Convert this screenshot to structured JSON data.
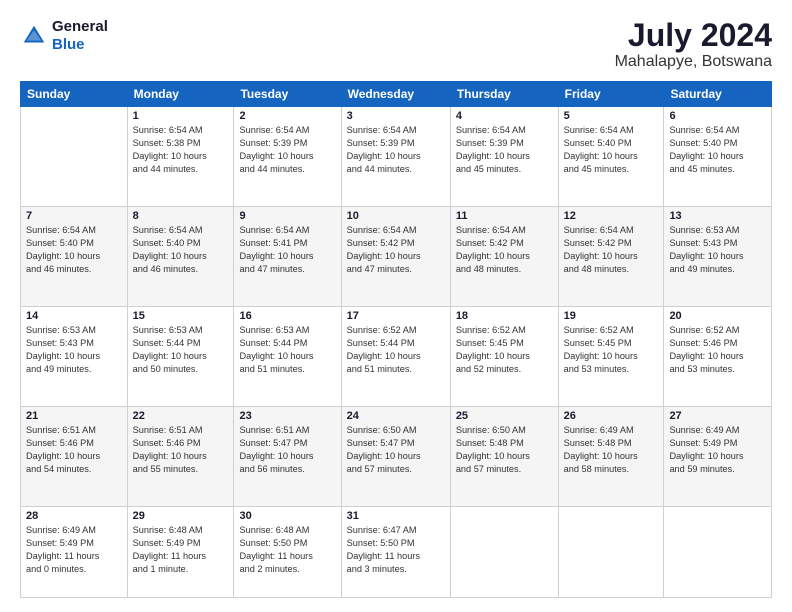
{
  "logo": {
    "line1": "General",
    "line2": "Blue"
  },
  "title": "July 2024",
  "subtitle": "Mahalapye, Botswana",
  "headers": [
    "Sunday",
    "Monday",
    "Tuesday",
    "Wednesday",
    "Thursday",
    "Friday",
    "Saturday"
  ],
  "weeks": [
    [
      {
        "date": "",
        "info": ""
      },
      {
        "date": "1",
        "info": "Sunrise: 6:54 AM\nSunset: 5:38 PM\nDaylight: 10 hours\nand 44 minutes."
      },
      {
        "date": "2",
        "info": "Sunrise: 6:54 AM\nSunset: 5:39 PM\nDaylight: 10 hours\nand 44 minutes."
      },
      {
        "date": "3",
        "info": "Sunrise: 6:54 AM\nSunset: 5:39 PM\nDaylight: 10 hours\nand 44 minutes."
      },
      {
        "date": "4",
        "info": "Sunrise: 6:54 AM\nSunset: 5:39 PM\nDaylight: 10 hours\nand 45 minutes."
      },
      {
        "date": "5",
        "info": "Sunrise: 6:54 AM\nSunset: 5:40 PM\nDaylight: 10 hours\nand 45 minutes."
      },
      {
        "date": "6",
        "info": "Sunrise: 6:54 AM\nSunset: 5:40 PM\nDaylight: 10 hours\nand 45 minutes."
      }
    ],
    [
      {
        "date": "7",
        "info": "Sunrise: 6:54 AM\nSunset: 5:40 PM\nDaylight: 10 hours\nand 46 minutes."
      },
      {
        "date": "8",
        "info": "Sunrise: 6:54 AM\nSunset: 5:40 PM\nDaylight: 10 hours\nand 46 minutes."
      },
      {
        "date": "9",
        "info": "Sunrise: 6:54 AM\nSunset: 5:41 PM\nDaylight: 10 hours\nand 47 minutes."
      },
      {
        "date": "10",
        "info": "Sunrise: 6:54 AM\nSunset: 5:42 PM\nDaylight: 10 hours\nand 47 minutes."
      },
      {
        "date": "11",
        "info": "Sunrise: 6:54 AM\nSunset: 5:42 PM\nDaylight: 10 hours\nand 48 minutes."
      },
      {
        "date": "12",
        "info": "Sunrise: 6:54 AM\nSunset: 5:42 PM\nDaylight: 10 hours\nand 48 minutes."
      },
      {
        "date": "13",
        "info": "Sunrise: 6:53 AM\nSunset: 5:43 PM\nDaylight: 10 hours\nand 49 minutes."
      }
    ],
    [
      {
        "date": "14",
        "info": "Sunrise: 6:53 AM\nSunset: 5:43 PM\nDaylight: 10 hours\nand 49 minutes."
      },
      {
        "date": "15",
        "info": "Sunrise: 6:53 AM\nSunset: 5:44 PM\nDaylight: 10 hours\nand 50 minutes."
      },
      {
        "date": "16",
        "info": "Sunrise: 6:53 AM\nSunset: 5:44 PM\nDaylight: 10 hours\nand 51 minutes."
      },
      {
        "date": "17",
        "info": "Sunrise: 6:52 AM\nSunset: 5:44 PM\nDaylight: 10 hours\nand 51 minutes."
      },
      {
        "date": "18",
        "info": "Sunrise: 6:52 AM\nSunset: 5:45 PM\nDaylight: 10 hours\nand 52 minutes."
      },
      {
        "date": "19",
        "info": "Sunrise: 6:52 AM\nSunset: 5:45 PM\nDaylight: 10 hours\nand 53 minutes."
      },
      {
        "date": "20",
        "info": "Sunrise: 6:52 AM\nSunset: 5:46 PM\nDaylight: 10 hours\nand 53 minutes."
      }
    ],
    [
      {
        "date": "21",
        "info": "Sunrise: 6:51 AM\nSunset: 5:46 PM\nDaylight: 10 hours\nand 54 minutes."
      },
      {
        "date": "22",
        "info": "Sunrise: 6:51 AM\nSunset: 5:46 PM\nDaylight: 10 hours\nand 55 minutes."
      },
      {
        "date": "23",
        "info": "Sunrise: 6:51 AM\nSunset: 5:47 PM\nDaylight: 10 hours\nand 56 minutes."
      },
      {
        "date": "24",
        "info": "Sunrise: 6:50 AM\nSunset: 5:47 PM\nDaylight: 10 hours\nand 57 minutes."
      },
      {
        "date": "25",
        "info": "Sunrise: 6:50 AM\nSunset: 5:48 PM\nDaylight: 10 hours\nand 57 minutes."
      },
      {
        "date": "26",
        "info": "Sunrise: 6:49 AM\nSunset: 5:48 PM\nDaylight: 10 hours\nand 58 minutes."
      },
      {
        "date": "27",
        "info": "Sunrise: 6:49 AM\nSunset: 5:49 PM\nDaylight: 10 hours\nand 59 minutes."
      }
    ],
    [
      {
        "date": "28",
        "info": "Sunrise: 6:49 AM\nSunset: 5:49 PM\nDaylight: 11 hours\nand 0 minutes."
      },
      {
        "date": "29",
        "info": "Sunrise: 6:48 AM\nSunset: 5:49 PM\nDaylight: 11 hours\nand 1 minute."
      },
      {
        "date": "30",
        "info": "Sunrise: 6:48 AM\nSunset: 5:50 PM\nDaylight: 11 hours\nand 2 minutes."
      },
      {
        "date": "31",
        "info": "Sunrise: 6:47 AM\nSunset: 5:50 PM\nDaylight: 11 hours\nand 3 minutes."
      },
      {
        "date": "",
        "info": ""
      },
      {
        "date": "",
        "info": ""
      },
      {
        "date": "",
        "info": ""
      }
    ]
  ]
}
